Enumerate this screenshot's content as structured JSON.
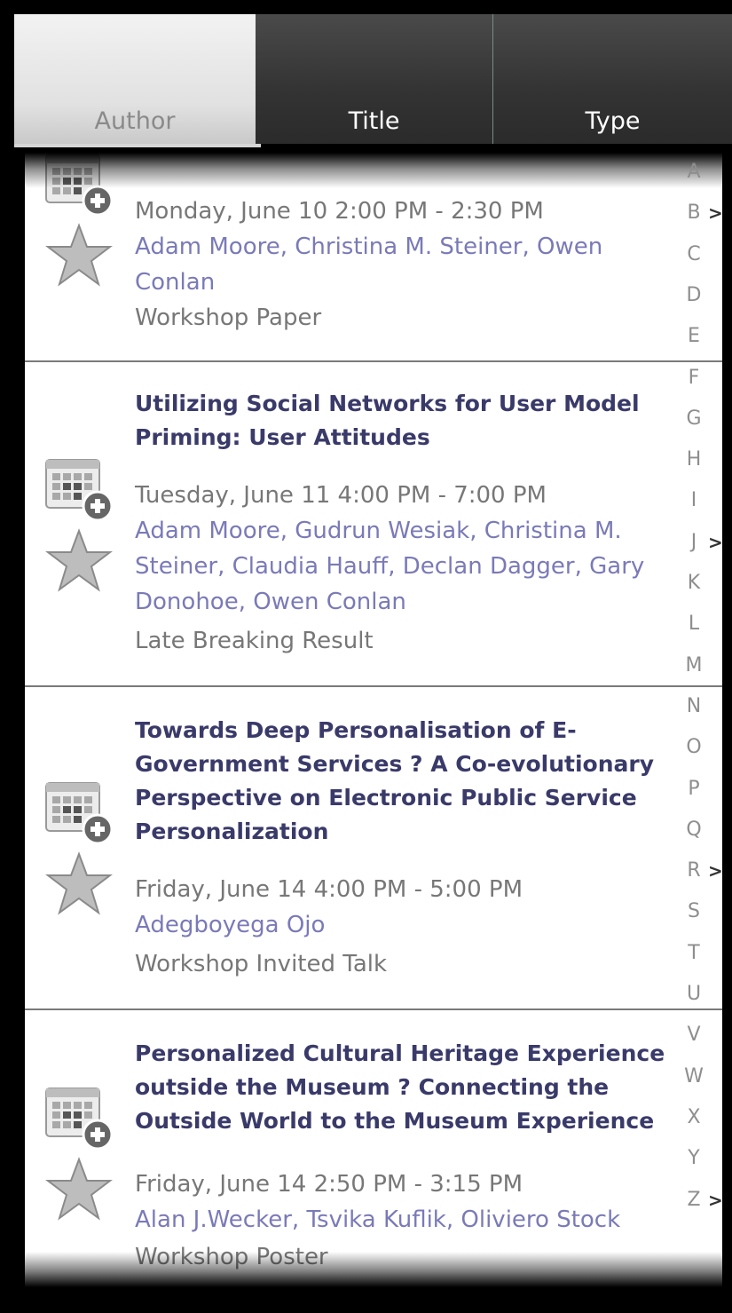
{
  "tabs": [
    {
      "label": "Author",
      "selected": true
    },
    {
      "label": "Title",
      "selected": false
    },
    {
      "label": "Type",
      "selected": false
    }
  ],
  "items": [
    {
      "title": "",
      "datetime": "Monday, June 10 2:00 PM - 2:30 PM",
      "authors": "Adam Moore, Christina M. Steiner, Owen Conlan",
      "type": "Workshop Paper"
    },
    {
      "title": "Utilizing Social Networks for User Model Priming: User Attitudes",
      "datetime": "Tuesday, June 11   4:00 PM - 7:00 PM",
      "authors": "Adam Moore, Gudrun Wesiak, Christina M. Steiner, Claudia Hauff, Declan Dagger, Gary Donohoe, Owen Conlan",
      "type": "Late Breaking Result"
    },
    {
      "title": "Towards Deep Personalisation of E-Government Services ? A Co-evolutionary Perspective on Electronic Public Service Personalization",
      "datetime": "Friday, June 14 4:00 PM - 5:00 PM",
      "authors": "Adegboyega Ojo",
      "type": "Workshop Invited Talk"
    },
    {
      "title": "Personalized Cultural Heritage Experience outside the Museum ? Connecting the Outside World to the Museum Experience",
      "datetime": "Friday, June 14 2:50 PM - 3:15 PM",
      "authors": "Alan J.Wecker, Tsvika Kuflik, Oliviero Stock",
      "type": "Workshop Poster"
    }
  ],
  "icons": {
    "calendar": "calendar-add-icon",
    "favorite": "star-icon",
    "arrow": "chevron-right-icon"
  },
  "index_letters": [
    "A",
    "B",
    "C",
    "D",
    "E",
    "F",
    "G",
    "H",
    "I",
    "J",
    "K",
    "L",
    "M",
    "N",
    "O",
    "P",
    "Q",
    "R",
    "S",
    "T",
    "U",
    "V",
    "W",
    "X",
    "Y",
    "Z"
  ],
  "index_arrow_glyph": ">",
  "index_marked_letters": [
    "B",
    "J",
    "R",
    "Z"
  ],
  "colors": {
    "title": "#3a3a6a",
    "authors": "#7a7ab8",
    "meta": "#777777",
    "tab_selected": "#e6e6e6",
    "tab_unselected": "#3b3b3b"
  }
}
